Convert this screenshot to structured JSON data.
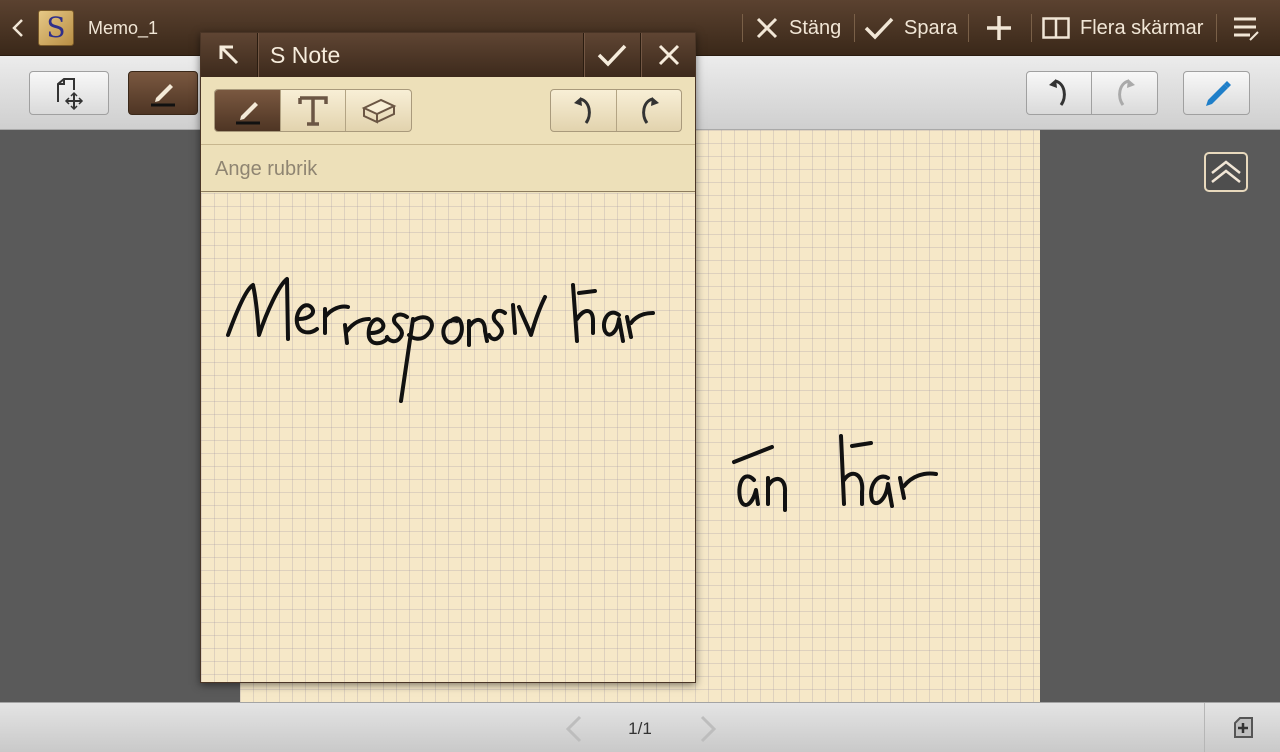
{
  "topbar": {
    "doc_title": "Memo_1",
    "app_icon_letter": "S",
    "close_label": "Stäng",
    "save_label": "Spara",
    "multiwindow_label": "Flera skärmar"
  },
  "popup": {
    "title": "S Note",
    "title_field_placeholder": "Ange rubrik",
    "handwriting": "Mer responsiv här"
  },
  "canvas": {
    "handwriting": "än här"
  },
  "pagination": {
    "page_indicator": "1/1"
  },
  "colors": {
    "brown_bar": "#4a3322",
    "paper": "#f6e8c8",
    "pen_blue": "#1f7fc9",
    "background": "#5a5a5a"
  },
  "icons": [
    "back-icon",
    "s-note-app-icon",
    "close-icon",
    "check-icon",
    "plus-icon",
    "multiwindow-icon",
    "menu-icon",
    "insert-icon",
    "pen-icon",
    "text-icon",
    "eraser-icon",
    "undo-icon",
    "redo-icon",
    "expand-icon",
    "chevron-up-icon",
    "chevron-left-icon",
    "chevron-right-icon",
    "add-page-icon"
  ]
}
